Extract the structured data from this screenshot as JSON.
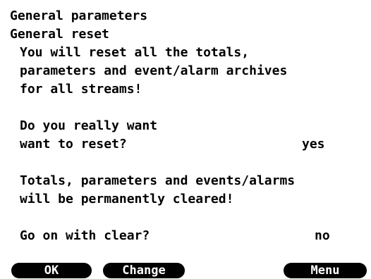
{
  "header": {
    "title": "General parameters",
    "subtitle": "General reset"
  },
  "warning": {
    "lines": [
      "You will reset all the totals,",
      "parameters and event/alarm archives",
      "for all streams!"
    ]
  },
  "question1": {
    "lines": [
      "Do you really want",
      "want to reset?"
    ],
    "value": "yes"
  },
  "notice": {
    "lines": [
      "Totals, parameters and events/alarms",
      "will be permanently cleared!"
    ]
  },
  "question2": {
    "label": "Go on with clear?",
    "value": "no"
  },
  "softkeys": {
    "ok": "OK",
    "change": "Change",
    "menu": "Menu"
  }
}
